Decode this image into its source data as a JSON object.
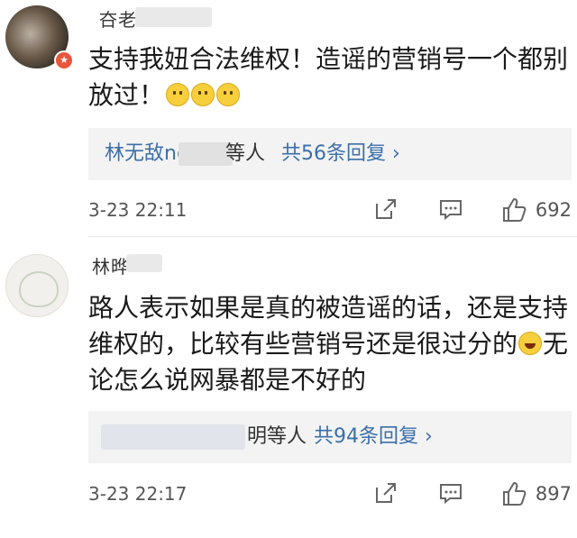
{
  "comments": [
    {
      "username": "夻老",
      "content_line1": "支持我妞合法维权！造谣的营销号一个都别",
      "content_line2": "放过！",
      "reply_names": "林无敌now",
      "reply_others": "等人",
      "reply_count": "共56条回复 ›",
      "time": "3-23 22:11",
      "likes": "692"
    },
    {
      "username": "林晔",
      "content_line1": "路人表示如果是真的被造谣的话，还是支持",
      "content_line2": "维权的，比较有些营销号还是很过分的",
      "content_line2b": "无",
      "content_line3": "论怎么说网暴都是不好的",
      "reply_names": "",
      "reply_others": "明等人",
      "reply_count": "共94条回复 ›",
      "time": "3-23 22:17",
      "likes": "897"
    }
  ],
  "icons": {
    "share": "share-icon",
    "comment": "comment-icon",
    "like": "thumbs-up-icon"
  }
}
